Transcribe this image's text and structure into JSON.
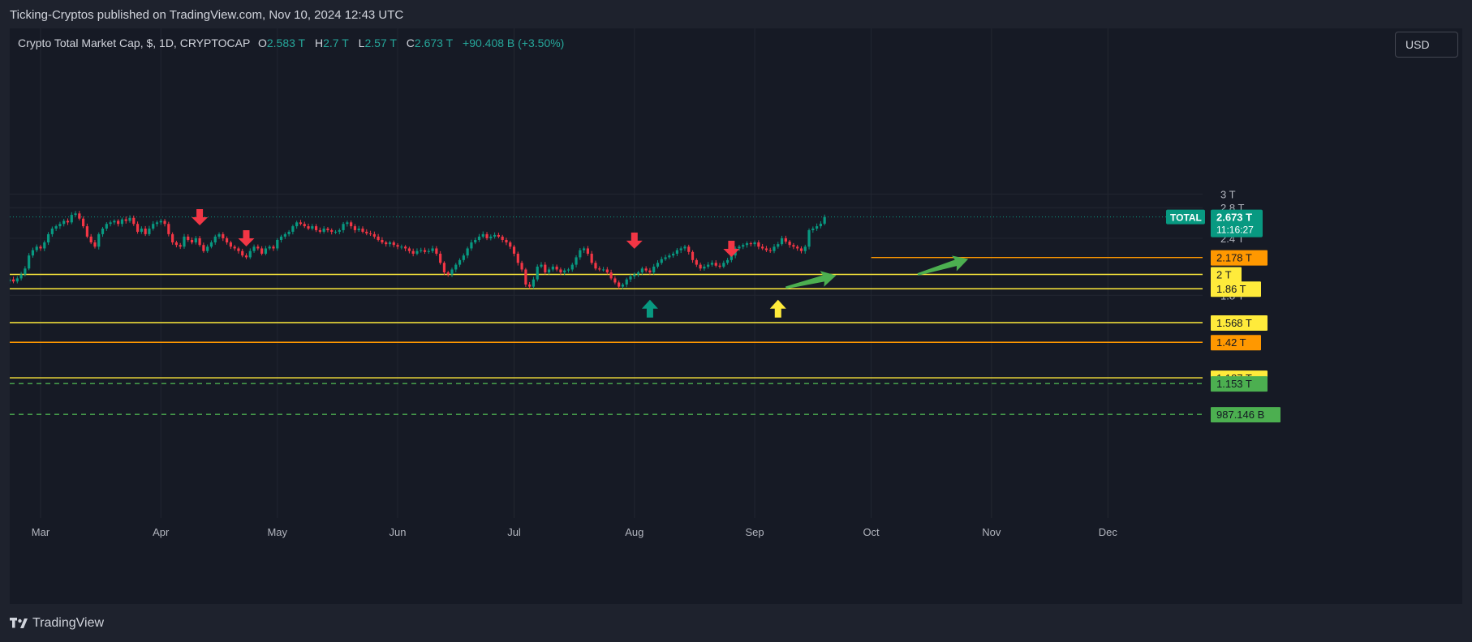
{
  "header": {
    "published_by": "Ticking-Cryptos published on TradingView.com, Nov 10, 2024 12:43 UTC"
  },
  "legend": {
    "symbol": "Crypto Total Market Cap, $, 1D, CRYPTOCAP",
    "o_label": "O",
    "o_value": "2.583 T",
    "h_label": "H",
    "h_value": "2.7 T",
    "l_label": "L",
    "l_value": "2.57 T",
    "c_label": "C",
    "c_value": "2.673 T",
    "change": "+90.408 B (+3.50%)"
  },
  "currency_button": {
    "label": "USD"
  },
  "footer": {
    "brand": "TradingView",
    "logo_icon": "tradingview-logo-icon"
  },
  "chart_data": {
    "type": "candlestick",
    "symbol": "TOTAL",
    "y_axis": {
      "scale": "log",
      "tick_labels": [
        "3 T",
        "2.8 T",
        "2.4 T",
        "1.8 T"
      ],
      "ticks": [
        3.0,
        2.8,
        2.4,
        1.8
      ]
    },
    "x_axis": {
      "tick_labels": [
        "Mar",
        "Apr",
        "May",
        "Jun",
        "Jul",
        "Aug",
        "Sep",
        "Oct",
        "Nov",
        "Dec"
      ],
      "ticks": [
        "2024-03-01",
        "2024-04-01",
        "2024-05-01",
        "2024-06-01",
        "2024-07-01",
        "2024-08-01",
        "2024-09-01",
        "2024-10-01",
        "2024-11-01",
        "2024-12-01"
      ]
    },
    "last_price": {
      "symbol_label": "TOTAL",
      "value_label": "2.673 T",
      "countdown": "11:16:27",
      "value": 2.673,
      "color": "#089981"
    },
    "close_series": {
      "start_date": "2024-02-22",
      "end_date": "2024-11-10",
      "closes": [
        1.95,
        1.93,
        1.96,
        2.0,
        2.06,
        2.2,
        2.26,
        2.3,
        2.28,
        2.35,
        2.45,
        2.52,
        2.55,
        2.58,
        2.62,
        2.6,
        2.7,
        2.72,
        2.65,
        2.55,
        2.42,
        2.35,
        2.3,
        2.45,
        2.52,
        2.58,
        2.6,
        2.62,
        2.58,
        2.64,
        2.62,
        2.66,
        2.58,
        2.48,
        2.52,
        2.45,
        2.52,
        2.58,
        2.6,
        2.62,
        2.58,
        2.45,
        2.35,
        2.32,
        2.3,
        2.42,
        2.38,
        2.35,
        2.4,
        2.32,
        2.25,
        2.3,
        2.35,
        2.42,
        2.45,
        2.4,
        2.35,
        2.3,
        2.28,
        2.25,
        2.2,
        2.18,
        2.25,
        2.3,
        2.28,
        2.22,
        2.28,
        2.3,
        2.28,
        2.38,
        2.42,
        2.45,
        2.48,
        2.55,
        2.6,
        2.58,
        2.55,
        2.52,
        2.55,
        2.5,
        2.48,
        2.52,
        2.5,
        2.48,
        2.48,
        2.5,
        2.58,
        2.6,
        2.55,
        2.5,
        2.52,
        2.48,
        2.46,
        2.45,
        2.42,
        2.38,
        2.35,
        2.33,
        2.35,
        2.32,
        2.3,
        2.3,
        2.28,
        2.25,
        2.22,
        2.25,
        2.26,
        2.24,
        2.25,
        2.28,
        2.22,
        2.12,
        2.02,
        2.0,
        2.05,
        2.1,
        2.15,
        2.2,
        2.28,
        2.35,
        2.38,
        2.42,
        2.45,
        2.4,
        2.42,
        2.44,
        2.42,
        2.38,
        2.35,
        2.3,
        2.22,
        2.12,
        2.05,
        1.9,
        1.88,
        1.95,
        2.08,
        2.1,
        2.02,
        2.05,
        2.08,
        2.05,
        2.02,
        2.04,
        2.05,
        2.1,
        2.18,
        2.26,
        2.28,
        2.22,
        2.12,
        2.06,
        2.05,
        2.05,
        2.02,
        1.96,
        1.92,
        1.88,
        1.9,
        1.95,
        1.98,
        2.0,
        2.02,
        2.06,
        2.04,
        2.02,
        2.08,
        2.12,
        2.16,
        2.18,
        2.2,
        2.22,
        2.26,
        2.28,
        2.3,
        2.24,
        2.15,
        2.1,
        2.06,
        2.08,
        2.1,
        2.12,
        2.09,
        2.08,
        2.12,
        2.15,
        2.2,
        2.28,
        2.3,
        2.32,
        2.34,
        2.33,
        2.35,
        2.3,
        2.28,
        2.26,
        2.25,
        2.3,
        2.33,
        2.4,
        2.36,
        2.32,
        2.3,
        2.28,
        2.25,
        2.3,
        2.5,
        2.52,
        2.55,
        2.583,
        2.673
      ]
    },
    "levels": [
      {
        "value": 2.178,
        "label": "2.178 T",
        "color": "#ff9800",
        "style": "solid",
        "x_start_date": "2024-10-01"
      },
      {
        "value": 2.0,
        "label": "2 T",
        "color": "#ffeb3b",
        "style": "solid"
      },
      {
        "value": 1.86,
        "label": "1.86 T",
        "color": "#ffeb3b",
        "style": "solid"
      },
      {
        "value": 1.568,
        "label": "1.568 T",
        "color": "#ffeb3b",
        "style": "solid"
      },
      {
        "value": 1.42,
        "label": "1.42 T",
        "color": "#ff9800",
        "style": "solid"
      },
      {
        "value": 1.187,
        "label": "1.187 T",
        "color": "#ffeb3b",
        "style": "solid"
      },
      {
        "value": 1.153,
        "label": "1.153 T",
        "color": "#4caf50",
        "style": "dashed"
      },
      {
        "value": 0.987146,
        "label": "987.146 B",
        "color": "#4caf50",
        "style": "dashed"
      }
    ],
    "annotations": [
      {
        "kind": "arrow-down",
        "color": "#f23645",
        "date": "2024-04-11",
        "value": 2.78
      },
      {
        "kind": "arrow-down",
        "color": "#f23645",
        "date": "2024-04-23",
        "value": 2.5
      },
      {
        "kind": "arrow-down",
        "color": "#f23645",
        "date": "2024-08-01",
        "value": 2.47
      },
      {
        "kind": "arrow-down",
        "color": "#f23645",
        "date": "2024-08-26",
        "value": 2.37
      },
      {
        "kind": "arrow-up",
        "color": "#089981",
        "date": "2024-08-05",
        "value": 1.76
      },
      {
        "kind": "arrow-up",
        "color": "#ffeb3b",
        "date": "2024-09-07",
        "value": 1.76
      },
      {
        "kind": "arrow-diagonal",
        "color": "#4caf50",
        "date_from": "2024-09-09",
        "value_from": 1.87,
        "date_to": "2024-09-22",
        "value_to": 1.99
      },
      {
        "kind": "arrow-diagonal",
        "color": "#4caf50",
        "date_from": "2024-10-13",
        "value_from": 2.0,
        "date_to": "2024-10-26",
        "value_to": 2.16
      }
    ],
    "colors": {
      "up": "#089981",
      "down": "#f23645",
      "background": "#161a25",
      "grid": "#222631",
      "axis_text": "#b2b5be"
    }
  }
}
